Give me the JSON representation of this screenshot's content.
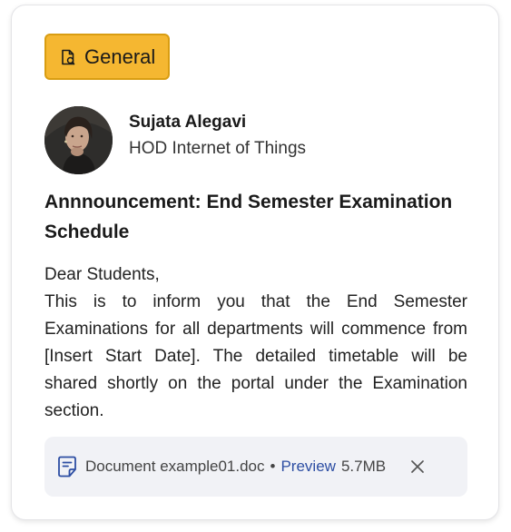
{
  "tag": {
    "label": "General",
    "icon": "file-document-icon",
    "color": "#f5b731"
  },
  "author": {
    "name": "Sujata Alegavi",
    "role": "HOD Internet of Things",
    "avatar": "avatar-photo"
  },
  "announcement": {
    "title": "Annnouncement: End Semester Examination Schedule",
    "greeting": "Dear Students,",
    "body": "This is to inform you that the End Semester Examinations for all departments will commence from [Insert Start Date]. The detailed timetable will be shared shortly on the portal under the Examination section."
  },
  "attachment": {
    "icon": "document-icon",
    "file_name": "Document example01.doc",
    "separator": "•",
    "preview_label": "Preview",
    "size": "5.7MB",
    "remove_icon": "close-icon",
    "link_color": "#2d4ea3"
  }
}
